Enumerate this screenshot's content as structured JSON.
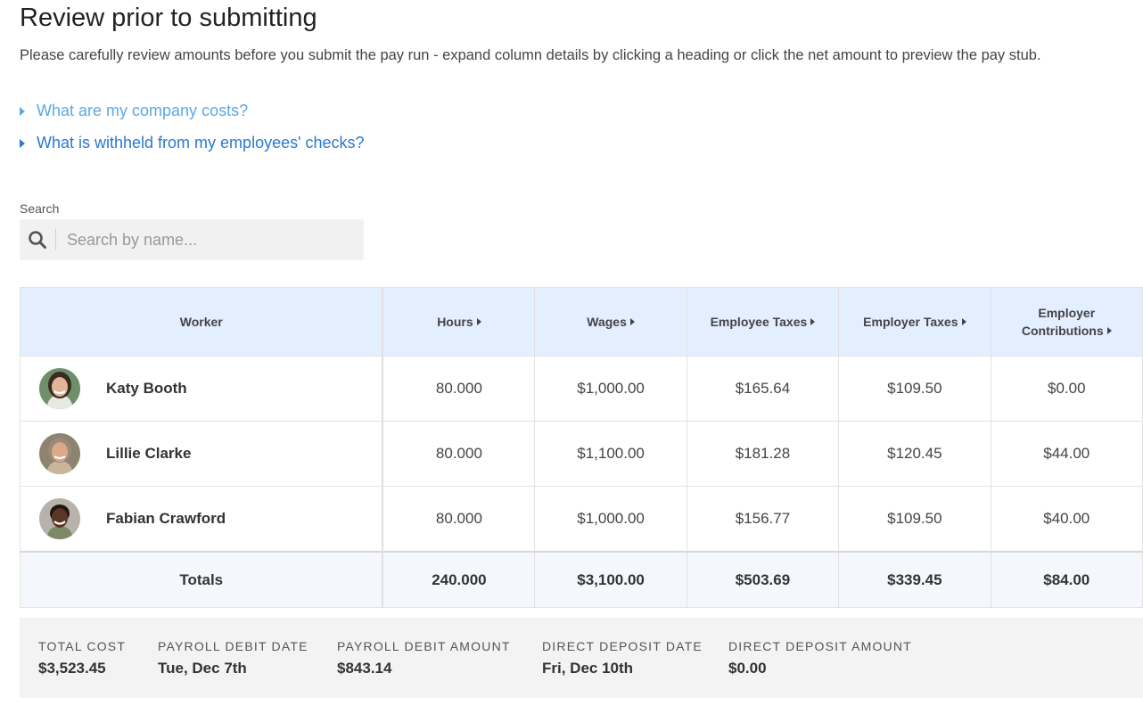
{
  "page": {
    "title": "Review prior to submitting",
    "subtitle": "Please carefully review amounts before you submit the pay run - expand column details by clicking a heading or click the net amount to preview the pay stub."
  },
  "faq": [
    {
      "label": "What are my company costs?",
      "color": "#5aa9e6"
    },
    {
      "label": "What is withheld from my employees' checks?",
      "color": "#2b78d0"
    }
  ],
  "search": {
    "label": "Search",
    "placeholder": "Search by name...",
    "value": ""
  },
  "table": {
    "headers": {
      "worker": "Worker",
      "hours": "Hours",
      "wages": "Wages",
      "employee_taxes": "Employee Taxes",
      "employer_taxes": "Employer Taxes",
      "employer_contributions_line1": "Employer",
      "employer_contributions_line2": "Contributions"
    },
    "rows": [
      {
        "name": "Katy Booth",
        "hours": "80.000",
        "wages": "$1,000.00",
        "employee_taxes": "$165.64",
        "employer_taxes": "$109.50",
        "employer_contributions": "$0.00"
      },
      {
        "name": "Lillie Clarke",
        "hours": "80.000",
        "wages": "$1,100.00",
        "employee_taxes": "$181.28",
        "employer_taxes": "$120.45",
        "employer_contributions": "$44.00"
      },
      {
        "name": "Fabian Crawford",
        "hours": "80.000",
        "wages": "$1,000.00",
        "employee_taxes": "$156.77",
        "employer_taxes": "$109.50",
        "employer_contributions": "$40.00"
      }
    ],
    "totals": {
      "label": "Totals",
      "hours": "240.000",
      "wages": "$3,100.00",
      "employee_taxes": "$503.69",
      "employer_taxes": "$339.45",
      "employer_contributions": "$84.00"
    },
    "header_bg": "#e3efff"
  },
  "summary": {
    "total_cost_label": "TOTAL COST",
    "total_cost": "$3,523.45",
    "payroll_debit_date_label": "PAYROLL DEBIT DATE",
    "payroll_debit_date": "Tue, Dec 7th",
    "payroll_debit_amount_label": "PAYROLL DEBIT AMOUNT",
    "payroll_debit_amount": "$843.14",
    "direct_deposit_date_label": "DIRECT DEPOSIT DATE",
    "direct_deposit_date": "Fri, Dec 10th",
    "direct_deposit_amount_label": "DIRECT DEPOSIT AMOUNT",
    "direct_deposit_amount": "$0.00"
  }
}
